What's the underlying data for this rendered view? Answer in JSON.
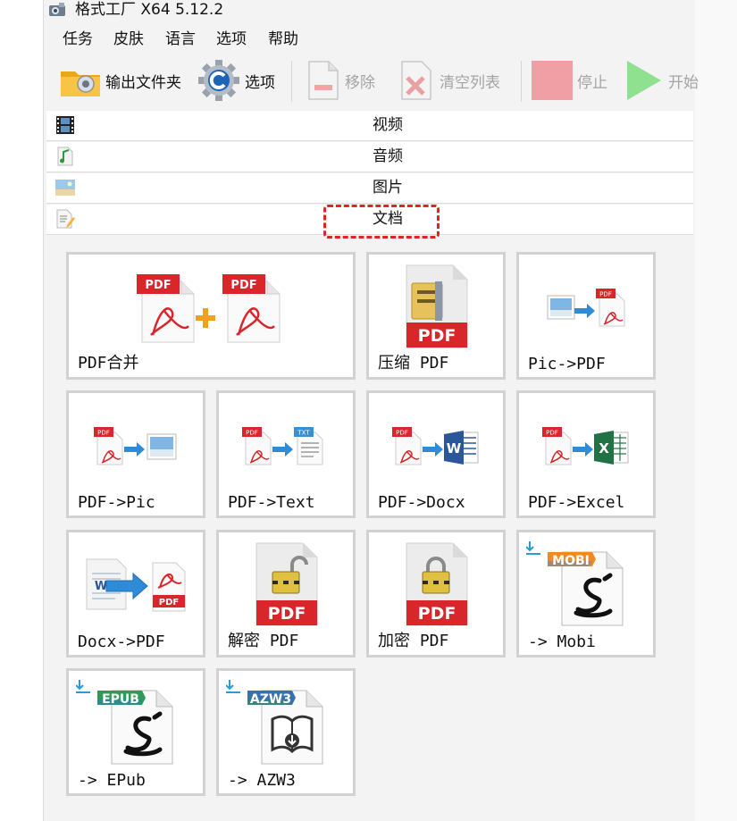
{
  "window": {
    "title": "格式工厂 X64 5.12.2"
  },
  "menu": [
    "任务",
    "皮肤",
    "语言",
    "选项",
    "帮助"
  ],
  "toolbar": {
    "output_folder": "输出文件夹",
    "options": "选项",
    "remove": "移除",
    "clear_list": "清空列表",
    "stop": "停止",
    "start": "开始"
  },
  "categories": [
    "视频",
    "音频",
    "图片",
    "文档"
  ],
  "tiles": [
    {
      "label": "PDF合并"
    },
    {
      "label": "压缩 PDF"
    },
    {
      "label": "Pic->PDF"
    },
    {
      "label": "PDF->Pic"
    },
    {
      "label": "PDF->Text"
    },
    {
      "label": "PDF->Docx"
    },
    {
      "label": "PDF->Excel"
    },
    {
      "label": "Docx->PDF"
    },
    {
      "label": "解密 PDF"
    },
    {
      "label": "加密 PDF"
    },
    {
      "label": "-> Mobi"
    },
    {
      "label": "-> EPub"
    },
    {
      "label": "-> AZW3"
    }
  ],
  "icon_text": {
    "pdf": "PDF",
    "txt": "TXT",
    "word": "W",
    "excel": "X",
    "mobi": "MOBI",
    "epub": "EPUB",
    "azw3": "AZW3"
  },
  "colors": {
    "pdf_red": "#d8262b",
    "stop_red": "#f0a0a4",
    "start_green": "#8fe08f",
    "highlight_dashed": "#e02424"
  }
}
